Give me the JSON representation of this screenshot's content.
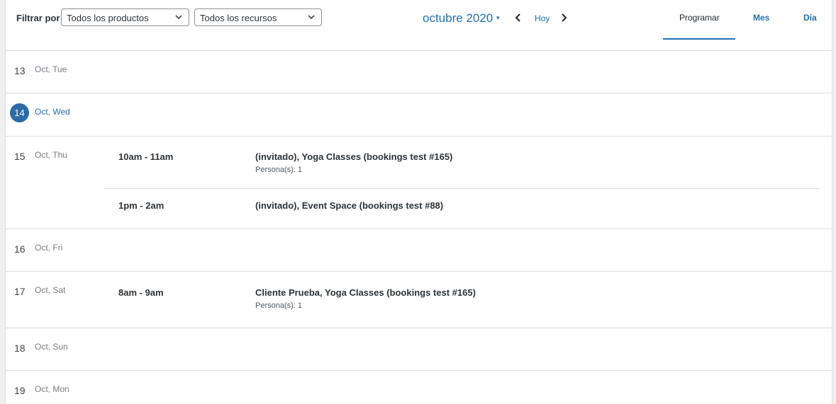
{
  "filters": {
    "label": "Filtrar por",
    "products_value": "Todos los productos",
    "resources_value": "Todos los recursos"
  },
  "nav": {
    "month_label": "octubre 2020",
    "caret": "▾",
    "today_label": "Hoy"
  },
  "views": {
    "schedule": "Programar",
    "month": "Mes",
    "day": "Día"
  },
  "days": [
    {
      "num": "13",
      "label": "Oct, Tue"
    },
    {
      "num": "14",
      "label": "Oct, Wed",
      "today": true
    },
    {
      "num": "15",
      "label": "Oct, Thu",
      "events": [
        {
          "time": "10am - 11am",
          "title": "(invitado), Yoga Classes (bookings test #165)",
          "meta": "Persona(s): 1"
        },
        {
          "time": "1pm - 2am",
          "title": "(invitado), Event Space (bookings test #88)"
        }
      ]
    },
    {
      "num": "16",
      "label": "Oct, Fri"
    },
    {
      "num": "17",
      "label": "Oct, Sat",
      "events": [
        {
          "time": "8am - 9am",
          "title": "Cliente Prueba, Yoga Classes (bookings test #165)",
          "meta": "Persona(s): 1"
        }
      ]
    },
    {
      "num": "18",
      "label": "Oct, Sun"
    },
    {
      "num": "19",
      "label": "Oct, Mon"
    }
  ],
  "colors": {
    "accent": "#2271b1",
    "today_badge": "#2c6ba5",
    "border": "#dcdcde"
  }
}
